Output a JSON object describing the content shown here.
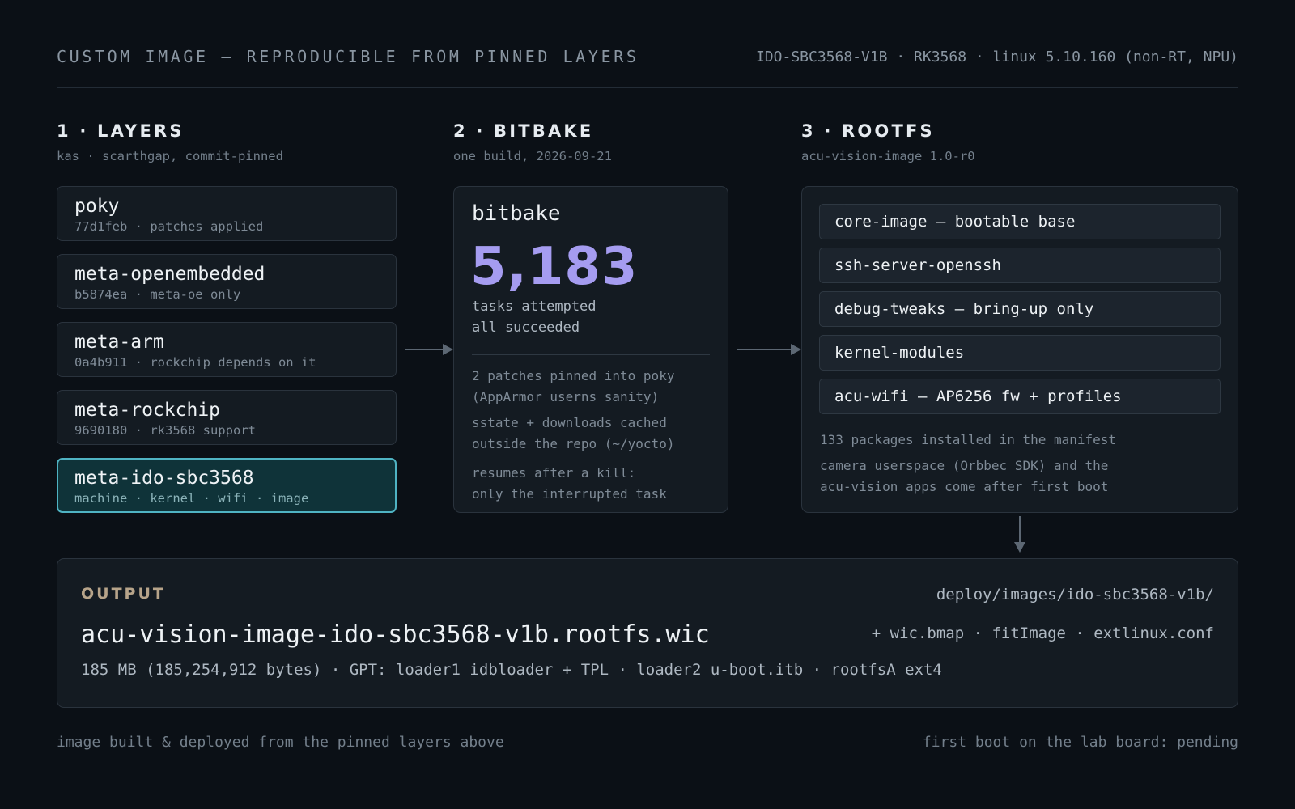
{
  "header": {
    "title": "CUSTOM IMAGE — REPRODUCIBLE FROM PINNED LAYERS",
    "target": "IDO-SBC3568-V1B · RK3568 · linux 5.10.160 (non-RT, NPU)"
  },
  "layers": {
    "title": "1 · LAYERS",
    "subtitle": "kas · scarthgap, commit-pinned",
    "items": [
      {
        "name": "poky",
        "meta": "77d1feb · patches applied"
      },
      {
        "name": "meta-openembedded",
        "meta": "b5874ea · meta-oe only"
      },
      {
        "name": "meta-arm",
        "meta": "0a4b911 · rockchip depends on it"
      },
      {
        "name": "meta-rockchip",
        "meta": "9690180 · rk3568 support"
      },
      {
        "name": "meta-ido-sbc3568",
        "meta": "machine · kernel · wifi · image"
      }
    ]
  },
  "bitbake": {
    "title": "2 · BITBAKE",
    "subtitle": "one build, 2026-09-21",
    "panel_title": "bitbake",
    "task_count": "5,183",
    "line1": "tasks attempted",
    "line2": "all succeeded",
    "notes": [
      [
        "2 patches pinned into poky",
        "(AppArmor userns sanity)"
      ],
      [
        "sstate + downloads cached",
        "outside the repo (~/yocto)"
      ],
      [
        "resumes after a kill:",
        "only the interrupted task"
      ]
    ]
  },
  "rootfs": {
    "title": "3 · ROOTFS",
    "subtitle": "acu-vision-image 1.0-r0",
    "packages": [
      "core-image — bootable base",
      "ssh-server-openssh",
      "debug-tweaks — bring-up only",
      "kernel-modules",
      "acu-wifi — AP6256 fw + profiles"
    ],
    "manifest_note": "133 packages installed in the manifest",
    "later_note": [
      "camera userspace (Orbbec SDK) and the",
      "acu-vision apps come after first boot"
    ]
  },
  "output": {
    "label": "OUTPUT",
    "path": "deploy/images/ido-sbc3568-v1b/",
    "file": "acu-vision-image-ido-sbc3568-v1b.rootfs.wic",
    "extras": "+ wic.bmap · fitImage · extlinux.conf",
    "detail": "185 MB (185,254,912 bytes) · GPT: loader1 idbloader + TPL · loader2 u-boot.itb · rootfsA ext4"
  },
  "footer": {
    "left": "image built & deployed from the pinned layers above",
    "right": "first boot on the lab board: pending"
  },
  "colors": {
    "background": "#0b1016",
    "accent_count": "#a59cf0",
    "active_layer_border": "#4fb3c3",
    "output_label": "#b7a48a"
  }
}
